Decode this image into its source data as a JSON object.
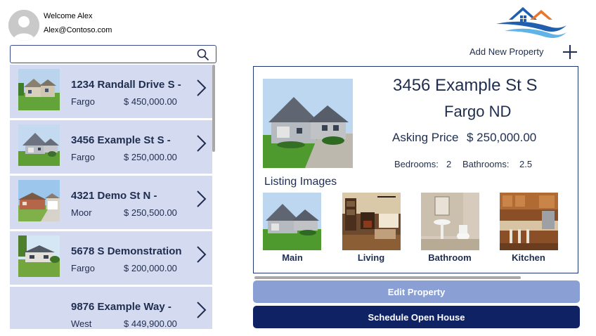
{
  "user": {
    "welcome": "Welcome Alex",
    "email": "Alex@Contoso.com"
  },
  "search": {
    "value": "",
    "placeholder": ""
  },
  "listings": [
    {
      "title": "1234 Randall Drive S -",
      "city": "Fargo",
      "price": "$ 450,000.00"
    },
    {
      "title": "3456 Example St S -",
      "city": "Fargo",
      "price": "$ 250,000.00"
    },
    {
      "title": "4321 Demo St N -",
      "city": "Moor",
      "price": "$ 250,500.00"
    },
    {
      "title": "5678 S Demonstration",
      "city": "Fargo",
      "price": "$ 200,000.00"
    },
    {
      "title": "9876 Example Way -",
      "city": "West",
      "price": "$ 449,900.00"
    }
  ],
  "toolbar": {
    "add_label": "Add New Property"
  },
  "detail": {
    "address": "3456 Example St S",
    "city": "Fargo ND",
    "asking_label": "Asking Price",
    "asking_value": "$ 250,000.00",
    "bedrooms_label": "Bedrooms:",
    "bedrooms_value": "2",
    "bathrooms_label": "Bathrooms:",
    "bathrooms_value": "2.5",
    "listing_images_heading": "Listing Images",
    "images": [
      {
        "caption": "Main"
      },
      {
        "caption": "Living"
      },
      {
        "caption": "Bathroom"
      },
      {
        "caption": "Kitchen"
      }
    ]
  },
  "actions": {
    "edit_label": "Edit Property",
    "schedule_label": "Schedule Open House"
  },
  "colors": {
    "accent_dark": "#0f2264",
    "accent_light": "#8aa0d4",
    "list_item_bg": "#d4daef",
    "text": "#1f2d4f",
    "logo_blue": "#1f5fae",
    "logo_orange": "#e8772e"
  }
}
